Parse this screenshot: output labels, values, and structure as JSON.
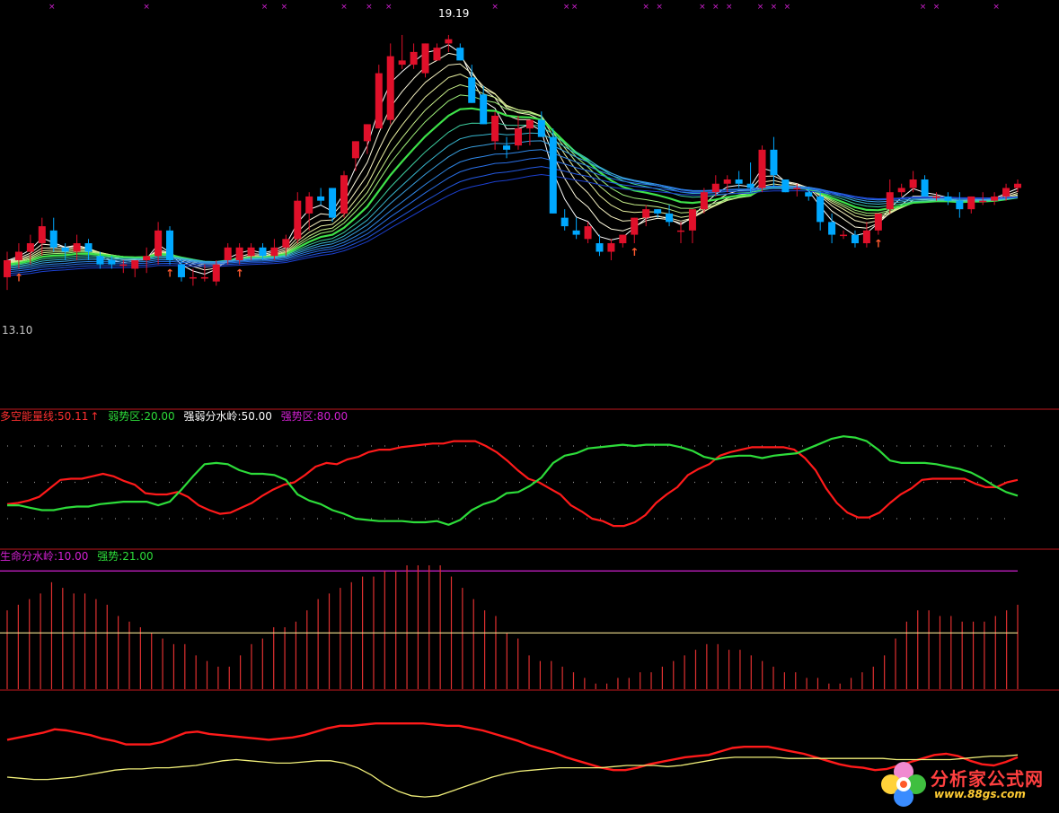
{
  "colors": {
    "background": "#000000",
    "divider": "#c0181e",
    "bull_candle": "#e0102a",
    "bear_candle": "#00a8ff",
    "red_line": "#ff1a1a",
    "green_line": "#2ddc3a",
    "yellow_line": "#f2f07a",
    "magenta": "#d020d0",
    "grid_dot": "#8a8a8a"
  },
  "price_panel": {
    "high_label": "19.19",
    "low_label": "13.10",
    "top_marker": "×",
    "up_marker": "↑"
  },
  "indicator_panel": {
    "legend": [
      {
        "text": "多空能量线:50.11",
        "color": "#ff3030",
        "arrow": "↑"
      },
      {
        "text": "弱势区:20.00",
        "color": "#2ddc3a"
      },
      {
        "text": "强弱分水岭:50.00",
        "color": "#ffffff"
      },
      {
        "text": "强势区:80.00",
        "color": "#d020d0"
      }
    ]
  },
  "volume_panel": {
    "legend": [
      {
        "text": "生命分水岭:10.00",
        "color": "#d020d0"
      },
      {
        "text": "强势:21.00",
        "color": "#2ddc3a"
      }
    ]
  },
  "watermark": {
    "text": "分析家公式网",
    "url": "www.88gs.com"
  },
  "chart_data": [
    {
      "type": "candlestick",
      "title": "",
      "high_label": 19.19,
      "low_label": 13.1,
      "ylim": [
        12.0,
        19.6
      ],
      "ohlc": [
        [
          13.5,
          14.1,
          13.2,
          13.9
        ],
        [
          13.9,
          14.3,
          13.7,
          14.1
        ],
        [
          14.1,
          14.5,
          13.8,
          14.3
        ],
        [
          14.3,
          14.9,
          14.0,
          14.7
        ],
        [
          14.6,
          14.9,
          14.1,
          14.2
        ],
        [
          14.2,
          14.3,
          13.9,
          14.1
        ],
        [
          14.1,
          14.5,
          13.9,
          14.3
        ],
        [
          14.3,
          14.4,
          13.9,
          14.1
        ],
        [
          14.0,
          14.1,
          13.7,
          13.8
        ],
        [
          13.9,
          14.0,
          13.7,
          13.8
        ],
        [
          13.8,
          13.9,
          13.6,
          13.8
        ],
        [
          13.7,
          13.9,
          13.5,
          13.9
        ],
        [
          13.9,
          14.2,
          13.6,
          14.0
        ],
        [
          14.0,
          14.8,
          13.8,
          14.6
        ],
        [
          14.6,
          14.7,
          13.8,
          13.9
        ],
        [
          13.8,
          13.9,
          13.4,
          13.5
        ],
        [
          13.5,
          13.7,
          13.3,
          13.5
        ],
        [
          13.5,
          13.8,
          13.4,
          13.5
        ],
        [
          13.4,
          13.9,
          13.3,
          13.8
        ],
        [
          13.9,
          14.3,
          13.8,
          14.2
        ],
        [
          13.9,
          14.3,
          13.8,
          14.2
        ],
        [
          14.0,
          14.3,
          13.9,
          14.2
        ],
        [
          14.2,
          14.3,
          13.9,
          14.0
        ],
        [
          14.0,
          14.4,
          13.9,
          14.2
        ],
        [
          14.2,
          14.5,
          14.0,
          14.4
        ],
        [
          14.4,
          15.5,
          14.3,
          15.3
        ],
        [
          15.0,
          15.5,
          14.6,
          15.4
        ],
        [
          15.4,
          15.6,
          15.2,
          15.3
        ],
        [
          15.6,
          15.6,
          14.8,
          14.9
        ],
        [
          15.0,
          16.0,
          14.9,
          15.9
        ],
        [
          16.3,
          16.7,
          16.0,
          16.7
        ],
        [
          16.7,
          17.1,
          16.4,
          17.1
        ],
        [
          17.0,
          18.5,
          17.0,
          18.3
        ],
        [
          17.2,
          19.0,
          17.1,
          18.7
        ],
        [
          18.5,
          19.2,
          18.4,
          18.6
        ],
        [
          18.5,
          19.0,
          18.4,
          18.8
        ],
        [
          18.3,
          19.0,
          18.2,
          19.0
        ],
        [
          18.6,
          19.0,
          18.6,
          18.9
        ],
        [
          19.0,
          19.2,
          18.8,
          19.1
        ],
        [
          18.9,
          19.0,
          18.6,
          18.6
        ],
        [
          18.2,
          18.5,
          17.6,
          17.6
        ],
        [
          17.8,
          18.0,
          17.1,
          17.1
        ],
        [
          16.7,
          17.4,
          16.5,
          17.3
        ],
        [
          16.6,
          16.8,
          16.3,
          16.5
        ],
        [
          16.6,
          17.3,
          16.5,
          17.0
        ],
        [
          17.0,
          17.2,
          16.6,
          17.2
        ],
        [
          17.2,
          17.4,
          16.8,
          16.8
        ],
        [
          16.8,
          17.0,
          15.0,
          15.0
        ],
        [
          14.9,
          15.1,
          14.6,
          14.7
        ],
        [
          14.6,
          14.9,
          14.4,
          14.5
        ],
        [
          14.4,
          14.8,
          14.3,
          14.7
        ],
        [
          14.3,
          14.5,
          14.0,
          14.1
        ],
        [
          14.1,
          14.4,
          13.9,
          14.3
        ],
        [
          14.3,
          14.5,
          14.2,
          14.5
        ],
        [
          14.5,
          14.9,
          14.3,
          14.9
        ],
        [
          14.9,
          15.2,
          14.7,
          15.1
        ],
        [
          15.1,
          15.1,
          14.9,
          15.0
        ],
        [
          15.0,
          15.2,
          14.7,
          14.8
        ],
        [
          14.6,
          14.8,
          14.3,
          14.6
        ],
        [
          14.6,
          15.1,
          14.3,
          15.1
        ],
        [
          15.1,
          15.6,
          15.0,
          15.5
        ],
        [
          15.5,
          15.9,
          15.4,
          15.7
        ],
        [
          15.7,
          15.9,
          15.5,
          15.8
        ],
        [
          15.8,
          16.0,
          15.6,
          15.7
        ],
        [
          15.7,
          16.2,
          15.5,
          15.6
        ],
        [
          15.6,
          16.6,
          15.5,
          16.5
        ],
        [
          16.5,
          16.8,
          15.6,
          15.9
        ],
        [
          15.8,
          15.8,
          15.5,
          15.5
        ],
        [
          15.6,
          15.7,
          15.4,
          15.6
        ],
        [
          15.5,
          15.6,
          15.3,
          15.4
        ],
        [
          15.4,
          15.5,
          14.6,
          14.8
        ],
        [
          14.8,
          15.0,
          14.3,
          14.5
        ],
        [
          14.5,
          14.6,
          14.4,
          14.5
        ],
        [
          14.5,
          14.6,
          14.2,
          14.3
        ],
        [
          14.3,
          14.8,
          14.2,
          14.6
        ],
        [
          14.6,
          15.0,
          14.5,
          15.0
        ],
        [
          15.1,
          15.8,
          15.0,
          15.5
        ],
        [
          15.5,
          15.7,
          15.4,
          15.6
        ],
        [
          15.6,
          16.0,
          15.5,
          15.8
        ],
        [
          15.8,
          15.9,
          15.4,
          15.4
        ],
        [
          15.4,
          15.5,
          15.3,
          15.4
        ],
        [
          15.4,
          15.5,
          15.2,
          15.3
        ],
        [
          15.3,
          15.5,
          14.9,
          15.1
        ],
        [
          15.1,
          15.4,
          15.0,
          15.4
        ],
        [
          15.3,
          15.5,
          15.2,
          15.3
        ],
        [
          15.3,
          15.5,
          15.2,
          15.4
        ],
        [
          15.4,
          15.7,
          15.3,
          15.6
        ],
        [
          15.6,
          15.8,
          15.5,
          15.7
        ]
      ]
    },
    {
      "type": "line",
      "title": "",
      "ylim": [
        0,
        100
      ],
      "reference_levels": [
        20,
        50,
        80
      ],
      "series": [
        {
          "name": "多空能量线",
          "color": "#ff1a1a",
          "values": [
            32,
            33,
            35,
            38,
            45,
            52,
            53,
            53,
            55,
            57,
            55,
            51,
            48,
            41,
            40,
            40,
            42,
            38,
            31,
            27,
            24,
            25,
            29,
            33,
            39,
            44,
            48,
            50,
            56,
            63,
            66,
            65,
            69,
            71,
            75,
            77,
            77,
            79,
            80,
            81,
            82,
            82,
            84,
            84,
            84,
            80,
            75,
            68,
            60,
            53,
            50,
            45,
            40,
            31,
            26,
            20,
            18,
            14,
            14,
            17,
            23,
            33,
            40,
            46,
            56,
            61,
            65,
            72,
            75,
            77,
            79,
            79,
            79,
            79,
            77,
            70,
            60,
            45,
            33,
            25,
            21,
            21,
            25,
            33,
            40,
            45,
            52,
            53,
            53,
            53,
            53,
            49,
            46,
            46,
            50,
            52
          ]
        },
        {
          "name": "强弱",
          "color": "#2ddc3a",
          "values": [
            31,
            31,
            29,
            27,
            27,
            29,
            30,
            30,
            32,
            33,
            34,
            34,
            34,
            31,
            34,
            44,
            55,
            65,
            66,
            65,
            60,
            57,
            57,
            56,
            52,
            40,
            35,
            32,
            27,
            24,
            20,
            19,
            18,
            18,
            18,
            17,
            17,
            18,
            15,
            19,
            27,
            32,
            35,
            41,
            42,
            47,
            54,
            66,
            72,
            74,
            78,
            79,
            80,
            81,
            80,
            81,
            81,
            81,
            79,
            76,
            71,
            69,
            71,
            72,
            72,
            70,
            72,
            73,
            74,
            78,
            82,
            86,
            88,
            87,
            84,
            77,
            68,
            66,
            66,
            66,
            65,
            63,
            61,
            58,
            53,
            47,
            42,
            39
          ]
        }
      ]
    },
    {
      "type": "bar",
      "title": "",
      "ylim": [
        0,
        22
      ],
      "reference_levels": [
        10,
        21
      ],
      "values": [
        14,
        15,
        16,
        17,
        19,
        18,
        17,
        17,
        16,
        15,
        13,
        12,
        11,
        10,
        9,
        8,
        8,
        6,
        5,
        4,
        4,
        6,
        8,
        9,
        11,
        11,
        12,
        14,
        16,
        17,
        18,
        19,
        20,
        20,
        21,
        21,
        22,
        22,
        22,
        22,
        20,
        18,
        16,
        14,
        13,
        10,
        9,
        6,
        5,
        5,
        4,
        3,
        2,
        1,
        1,
        2,
        2,
        3,
        3,
        4,
        5,
        6,
        7,
        8,
        8,
        7,
        7,
        6,
        5,
        4,
        3,
        3,
        2,
        2,
        1,
        1,
        2,
        3,
        4,
        6,
        9,
        12,
        14,
        14,
        13,
        13,
        12,
        12,
        12,
        13,
        14,
        15
      ]
    },
    {
      "type": "line",
      "title": "",
      "series": [
        {
          "name": "",
          "color": "#ff1a1a",
          "values": [
            62,
            64,
            66,
            68,
            71,
            70,
            68,
            66,
            63,
            61,
            58,
            58,
            58,
            60,
            64,
            68,
            69,
            67,
            66,
            65,
            64,
            63,
            62,
            63,
            64,
            66,
            69,
            72,
            74,
            74,
            75,
            76,
            76,
            76,
            76,
            76,
            75,
            74,
            74,
            72,
            70,
            67,
            64,
            61,
            57,
            54,
            51,
            47,
            44,
            41,
            38,
            36,
            36,
            38,
            41,
            43,
            45,
            47,
            48,
            49,
            52,
            55,
            56,
            56,
            56,
            54,
            52,
            50,
            47,
            44,
            41,
            39,
            38,
            36,
            37,
            40,
            43,
            46,
            49,
            50,
            48,
            44,
            41,
            40,
            43,
            47
          ]
        },
        {
          "name": "",
          "color": "#f2f07a",
          "values": [
            30,
            29,
            28,
            28,
            29,
            30,
            32,
            34,
            36,
            37,
            37,
            38,
            38,
            39,
            40,
            42,
            44,
            45,
            44,
            43,
            42,
            42,
            43,
            44,
            44,
            42,
            38,
            32,
            24,
            18,
            14,
            13,
            14,
            18,
            22,
            26,
            30,
            33,
            35,
            36,
            37,
            38,
            38,
            38,
            38,
            39,
            40,
            40,
            40,
            39,
            40,
            42,
            44,
            46,
            47,
            47,
            47,
            47,
            46,
            46,
            46,
            46,
            46,
            46,
            46,
            46,
            45,
            45,
            45,
            45,
            45,
            46,
            47,
            48,
            48,
            49
          ]
        }
      ]
    }
  ]
}
